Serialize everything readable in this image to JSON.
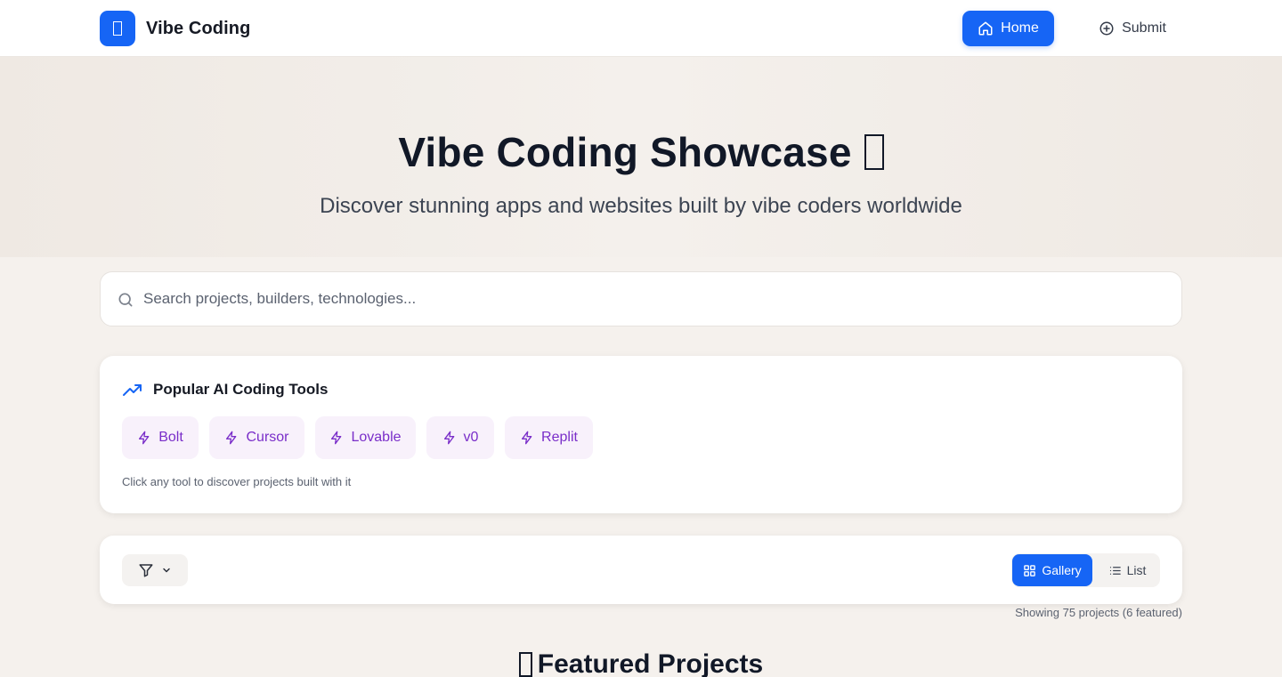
{
  "header": {
    "brand_name": "Vibe Coding",
    "nav": {
      "home_label": "Home",
      "submit_label": "Submit"
    }
  },
  "hero": {
    "title": "Vibe Coding Showcase",
    "subtitle": "Discover stunning apps and websites built by vibe coders worldwide"
  },
  "search": {
    "placeholder": "Search projects, builders, technologies...",
    "value": ""
  },
  "tools": {
    "title": "Popular AI Coding Tools",
    "items": [
      "Bolt",
      "Cursor",
      "Lovable",
      "v0",
      "Replit"
    ],
    "hint": "Click any tool to discover projects built with it"
  },
  "controls": {
    "gallery_label": "Gallery",
    "list_label": "List",
    "active_view": "gallery",
    "results_text": "Showing 75 projects (6 featured)"
  },
  "featured": {
    "heading": "Featured Projects"
  },
  "colors": {
    "accent": "#1665f5",
    "chip_bg": "#f8f1fb",
    "chip_text": "#7a2ec9",
    "page_bg": "#f5f1ed"
  },
  "icons": {
    "brand": "missing-glyph-icon",
    "home": "home-icon",
    "submit": "plus-circle-icon",
    "search": "search-icon",
    "tools_heading": "trending-up-icon",
    "tool_chip": "lightning-icon",
    "filter": "filter-icon",
    "chevron": "chevron-down-icon",
    "gallery": "grid-icon",
    "list": "list-icon"
  }
}
